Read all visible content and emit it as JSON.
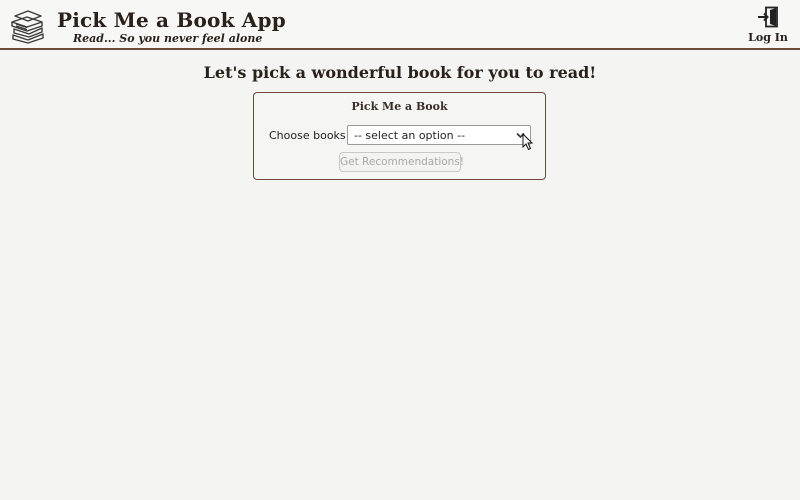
{
  "header": {
    "logo_icon": "books-stack-icon",
    "title": "Pick Me a Book App",
    "tagline": "Read... So you never feel alone",
    "login_icon": "sign-in-door-icon",
    "login_label": "Log In"
  },
  "main": {
    "heading": "Let's pick a wonderful book for you to read!",
    "card": {
      "title": "Pick Me a Book",
      "choose_label": "Choose books",
      "select_value": "-- select an option --",
      "button_label": "Get Recommendations!",
      "button_disabled": true
    }
  },
  "colors": {
    "accent": "#6b4a3a",
    "background": "#f4f4f3",
    "text": "#2a211b"
  }
}
